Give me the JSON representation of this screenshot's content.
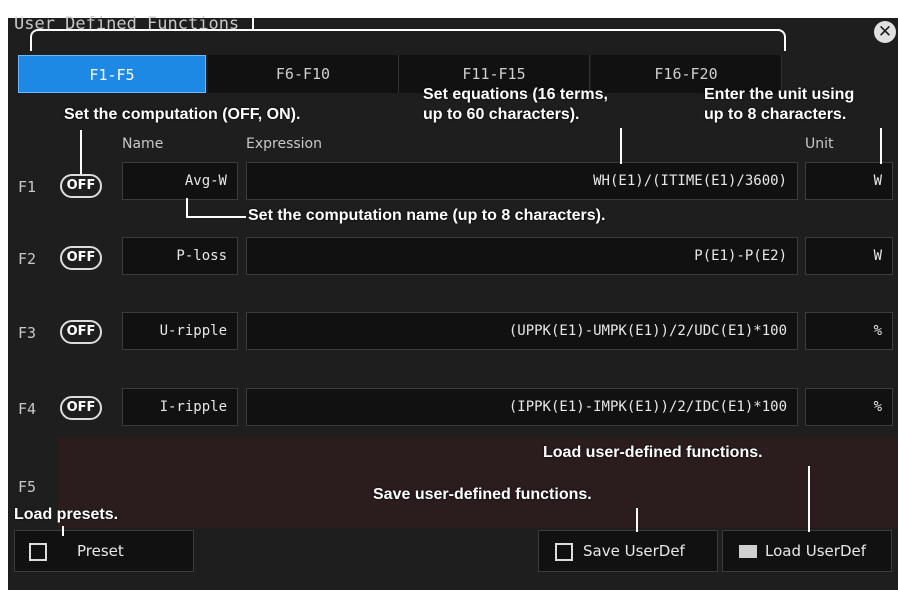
{
  "window": {
    "title": "User Defined Functions",
    "close_icon": "close-icon"
  },
  "tabs": [
    "F1-F5",
    "F6-F10",
    "F11-F15",
    "F16-F20"
  ],
  "columns": {
    "name": "Name",
    "expression": "Expression",
    "unit": "Unit"
  },
  "rows": [
    {
      "id": "F1",
      "state": "OFF",
      "name": "Avg-W",
      "expression": "WH(E1)/(ITIME(E1)/3600)",
      "unit": "W"
    },
    {
      "id": "F2",
      "state": "OFF",
      "name": "P-loss",
      "expression": "P(E1)-P(E2)",
      "unit": "W"
    },
    {
      "id": "F3",
      "state": "OFF",
      "name": "U-ripple",
      "expression": "(UPPK(E1)-UMPK(E1))/2/UDC(E1)*100",
      "unit": "%"
    },
    {
      "id": "F4",
      "state": "OFF",
      "name": "I-ripple",
      "expression": "(IPPK(E1)-IMPK(E1))/2/IDC(E1)*100",
      "unit": "%"
    },
    {
      "id": "F5"
    }
  ],
  "buttons": {
    "preset": "Preset",
    "save": "Save UserDef",
    "load": "Load UserDef"
  },
  "annotations": {
    "computation": "Set the computation (OFF, ON).",
    "equations_1": "Set equations (16 terms,",
    "equations_2": "up to 60 characters).",
    "unit_1": "Enter the unit using",
    "unit_2": "up to 8 characters.",
    "name": "Set the computation name (up to 8 characters).",
    "load_udf": "Load user-defined functions.",
    "save_udf": "Save user-defined functions.",
    "load_presets": "Load presets."
  }
}
